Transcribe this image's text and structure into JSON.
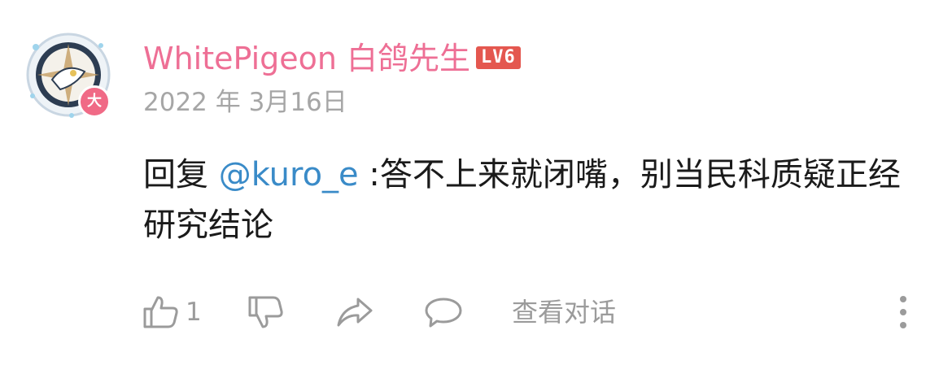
{
  "comment": {
    "author": {
      "name": "WhitePigeon 白鸽先生",
      "level_badge": "LV6",
      "avatar_badge": "大",
      "name_color": "#ee6f95"
    },
    "timestamp": "2022 年 3月16日",
    "content": {
      "reply_prefix": "回复",
      "mention": "@kuro_e",
      "text": ":答不上来就闭嘴，别当民科质疑正经研究结论"
    },
    "actions": {
      "like_icon": "thumbs-up-icon",
      "like_count": "1",
      "dislike_icon": "thumbs-down-icon",
      "share_icon": "share-arrow-icon",
      "reply_icon": "speech-bubble-icon",
      "view_thread_label": "查看对话",
      "more_icon": "more-vertical-icon"
    }
  },
  "colors": {
    "mention": "#3a8bc8",
    "level_badge_bg": "#e4574f",
    "muted": "#9b9b9b"
  }
}
